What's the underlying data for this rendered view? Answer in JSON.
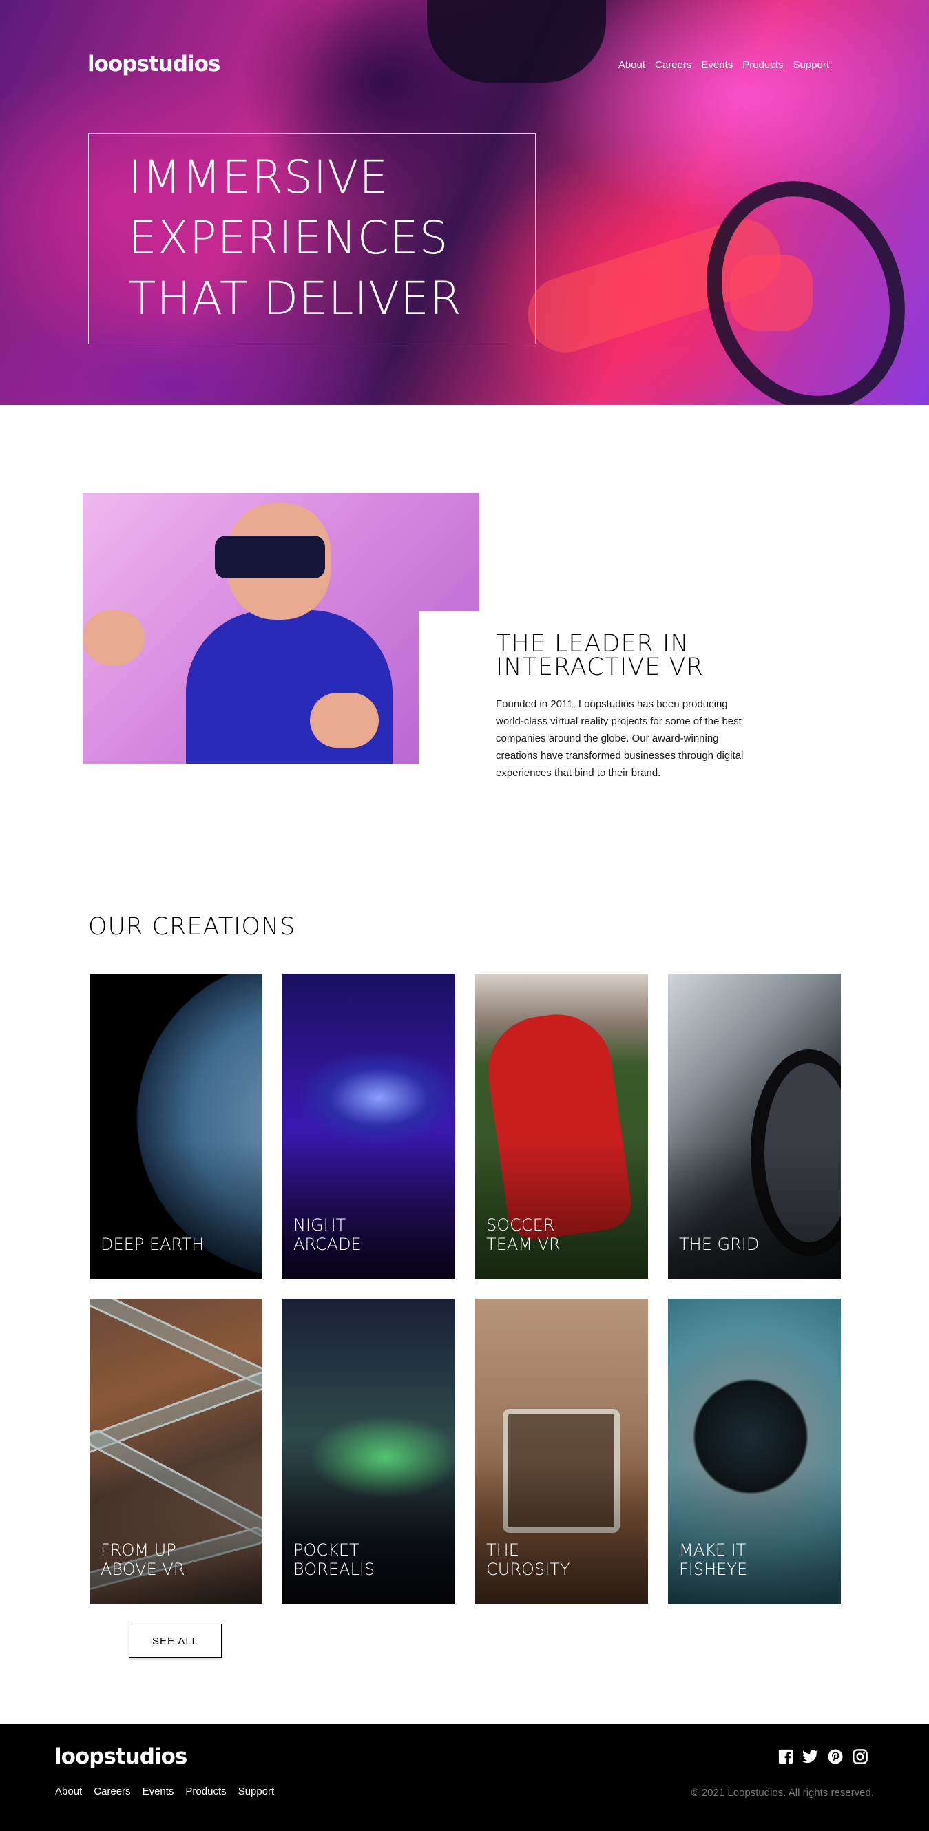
{
  "brand": {
    "logo_text": "loopstudios"
  },
  "nav": {
    "items": [
      {
        "label": "About"
      },
      {
        "label": "Careers"
      },
      {
        "label": "Events"
      },
      {
        "label": "Products"
      },
      {
        "label": "Support"
      }
    ]
  },
  "hero": {
    "headline_line1": "IMMERSIVE",
    "headline_line2": "EXPERIENCES",
    "headline_line3": "THAT DELIVER"
  },
  "intro": {
    "heading_line1": "THE LEADER IN",
    "heading_line2": "INTERACTIVE VR",
    "body": "Founded in 2011, Loopstudios has been producing world-class virtual reality projects for some of the best companies around the globe. Our award-winning creations have transformed businesses through digital experiences that bind to their brand."
  },
  "creations": {
    "title": "OUR CREATIONS",
    "cards": [
      {
        "line1": "DEEP EARTH",
        "line2": ""
      },
      {
        "line1": "NIGHT",
        "line2": "ARCADE"
      },
      {
        "line1": "SOCCER",
        "line2": "TEAM VR"
      },
      {
        "line1": "THE GRID",
        "line2": ""
      },
      {
        "line1": "FROM UP",
        "line2": "ABOVE VR"
      },
      {
        "line1": "POCKET",
        "line2": "BOREALIS"
      },
      {
        "line1": "THE",
        "line2": "CUROSITY"
      },
      {
        "line1": "MAKE IT",
        "line2": "FISHEYE"
      }
    ],
    "see_all_label": "SEE ALL"
  },
  "footer": {
    "logo_text": "loopstudios",
    "nav": [
      {
        "label": "About"
      },
      {
        "label": "Careers"
      },
      {
        "label": "Events"
      },
      {
        "label": "Products"
      },
      {
        "label": "Support"
      }
    ],
    "socials": [
      "facebook-icon",
      "twitter-icon",
      "pinterest-icon",
      "instagram-icon"
    ],
    "copyright": "© 2021 Loopstudios. All rights reserved."
  }
}
